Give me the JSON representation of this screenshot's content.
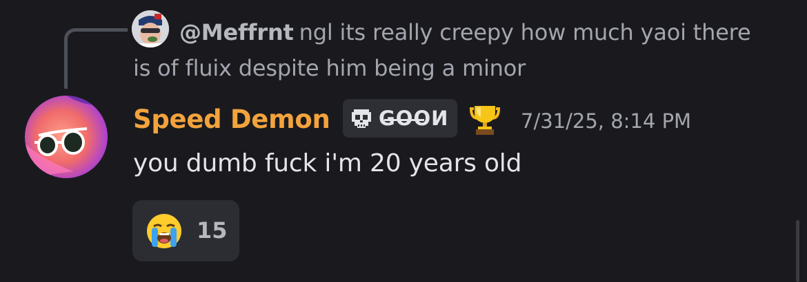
{
  "reply": {
    "author": "@Meffrnt",
    "text": "ngl its really creepy how much yaoi there is of fluix despite him being a minor"
  },
  "message": {
    "username": "Speed Demon",
    "tag": "GOOИ",
    "timestamp": "7/31/25, 8:14 PM",
    "text": "you dumb fuck i'm 20 years old",
    "username_color": "#f3a33c"
  },
  "reaction": {
    "icon": "loudly-crying-face-icon",
    "count": "15"
  },
  "icons": {
    "tag": "skull-icon",
    "badge": "trophy-icon"
  }
}
